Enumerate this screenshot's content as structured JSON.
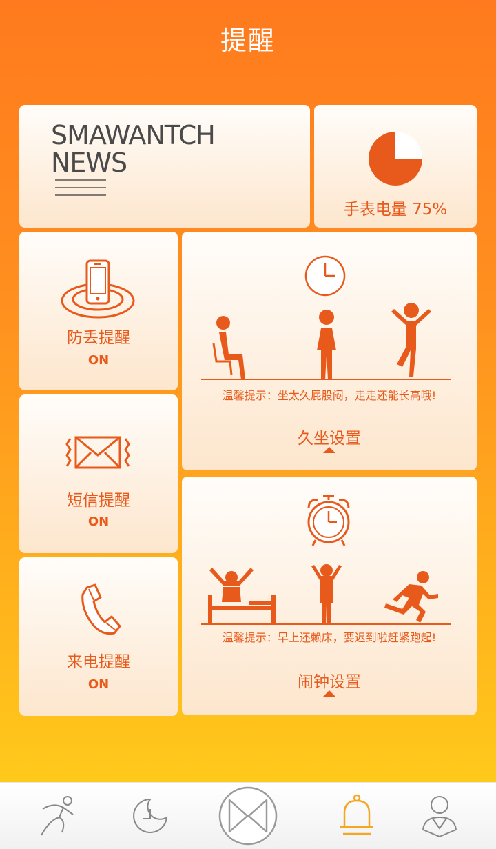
{
  "header": {
    "title": "提醒"
  },
  "news_card": {
    "line1": "SMAWANTCH",
    "line2": "NEWS"
  },
  "battery": {
    "label": "手表电量 75%",
    "percent": 75
  },
  "anti_loss": {
    "label": "防丢提醒",
    "status": "ON"
  },
  "sms": {
    "label": "短信提醒",
    "status": "ON"
  },
  "call": {
    "label": "来电提醒",
    "status": "ON"
  },
  "sedentary": {
    "hint": "温馨提示：坐太久屁股闷，走走还能长高哦!",
    "setting_label": "久坐设置"
  },
  "alarm": {
    "hint": "温馨提示：早上还赖床，要迟到啦赶紧跑起!",
    "setting_label": "闹钟设置"
  },
  "tabbar": {
    "items": [
      {
        "icon": "running-icon",
        "active": false
      },
      {
        "icon": "sleep-moon-icon",
        "active": false
      },
      {
        "icon": "center-logo-icon",
        "active": false
      },
      {
        "icon": "bell-icon",
        "active": true
      },
      {
        "icon": "user-profile-icon",
        "active": false
      }
    ]
  },
  "colors": {
    "accent": "#e85a1c",
    "active_tab": "#f5a623",
    "inactive_tab": "#888888"
  }
}
